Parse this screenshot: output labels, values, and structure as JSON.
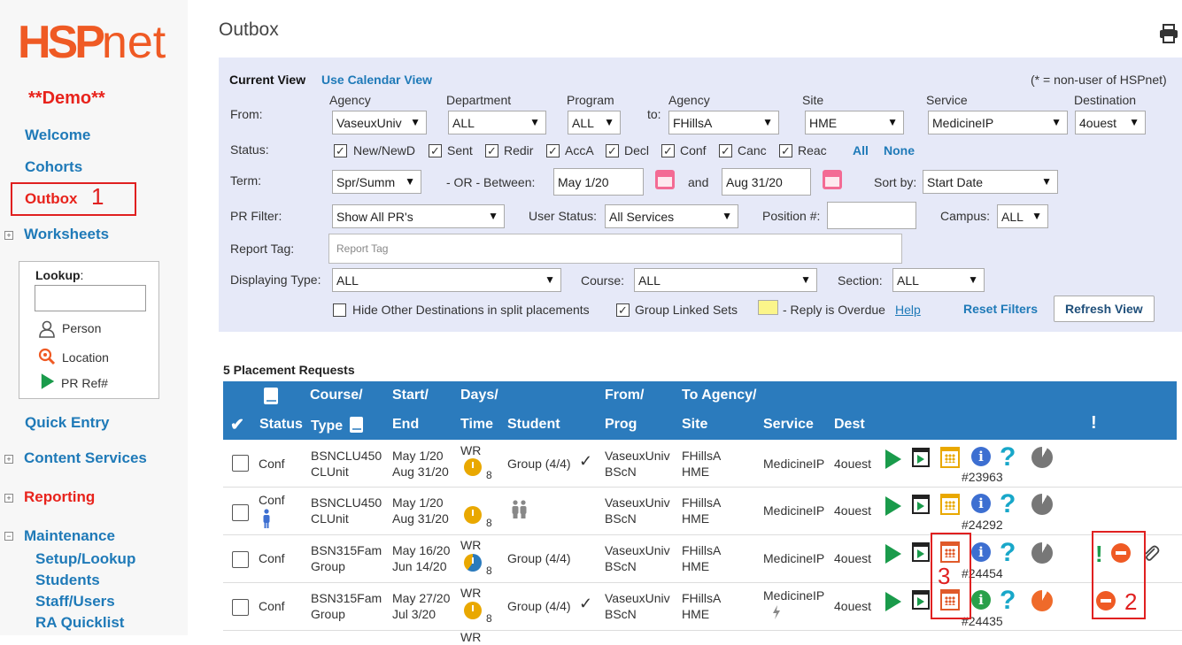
{
  "sidebar": {
    "logo": "HSP",
    "logo_net": "net",
    "demo": "**Demo**",
    "welcome": "Welcome",
    "cohorts": "Cohorts",
    "outbox": "Outbox",
    "worksheets": "Worksheets",
    "lookup_label": "Lookup",
    "lookup_colon": ":",
    "person": "Person",
    "location": "Location",
    "pr_ref": "PR Ref#",
    "quick_entry": "Quick Entry",
    "content_services": "Content Services",
    "reporting": "Reporting",
    "maintenance": "Maintenance",
    "setup_lookup": "Setup/Lookup",
    "students": "Students",
    "staff_users": "Staff/Users",
    "ra_quicklist": "RA Quicklist",
    "plus": "+",
    "minus": "−"
  },
  "annotations": {
    "a1": "1",
    "a2": "2",
    "a3": "3"
  },
  "page": {
    "title": "Outbox"
  },
  "filters": {
    "current_view": "Current View",
    "calendar_view": "Use Calendar View",
    "non_user_note": "(* = non-user of HSPnet)",
    "from": "From:",
    "to": "to:",
    "agency_label": "Agency",
    "department_label": "Department",
    "program_label": "Program",
    "agency_to_label": "Agency",
    "site_label": "Site",
    "service_label": "Service",
    "destination_label": "Destination",
    "agency_value": "VaseuxUniv",
    "department_value": "ALL",
    "program_value": "ALL",
    "agency_to_value": "FHillsA",
    "site_value": "HME",
    "service_value": "MedicineIP",
    "destination_value": "4ouest",
    "status_label": "Status:",
    "statuses": [
      "New/NewD",
      "Sent",
      "Redir",
      "AccA",
      "Decl",
      "Conf",
      "Canc",
      "Reac"
    ],
    "all": "All",
    "none": "None",
    "term_label": "Term:",
    "term_value": "Spr/Summ",
    "or_between": "- OR -  Between:",
    "date_from": "May 1/20",
    "and": "and",
    "date_to": "Aug 31/20",
    "sort_by": "Sort by:",
    "sort_value": "Start Date",
    "pr_filter": "PR Filter:",
    "pr_filter_value": "Show All PR's",
    "user_status": "User Status:",
    "user_status_value": "All Services",
    "position": "Position #:",
    "campus": "Campus:",
    "campus_value": "ALL",
    "report_tag": "Report Tag:",
    "report_tag_placeholder": "Report Tag",
    "displaying_type": "Displaying Type:",
    "displaying_type_value": "ALL",
    "course": "Course:",
    "course_value": "ALL",
    "section": "Section:",
    "section_value": "ALL",
    "hide_other": "Hide Other Destinations in split placements",
    "group_linked": "Group Linked Sets",
    "overdue": "- Reply is Overdue",
    "help": "Help",
    "reset": "Reset Filters",
    "refresh": "Refresh View",
    "check": "✓"
  },
  "table": {
    "count": "5 Placement Requests",
    "headers": {
      "status": "Status",
      "course1": "Course/",
      "course2": "Type",
      "start1": "Start/",
      "start2": "End",
      "days1": "Days/",
      "days2": "Time",
      "student": "Student",
      "from1": "From/",
      "from2": "Prog",
      "to1": "To Agency/",
      "to2": "Site",
      "service": "Service",
      "dest": "Dest",
      "excl": "!",
      "check": "✔"
    },
    "rows": [
      {
        "status": "Conf",
        "course": "BSNCLU450",
        "type": "CLUnit",
        "start": "May 1/20",
        "end": "Aug 31/20",
        "days": "WR",
        "time": "8",
        "student": "Group (4/4)",
        "from": "VaseuxUniv",
        "prog": "BScN",
        "to": "FHillsA",
        "site": "HME",
        "service": "MedicineIP",
        "dest": "4ouest",
        "ref": "#23963"
      },
      {
        "status": "Conf",
        "course": "BSNCLU450",
        "type": "CLUnit",
        "start": "May 1/20",
        "end": "Aug 31/20",
        "days": "",
        "time": "8",
        "student": "",
        "from": "VaseuxUniv",
        "prog": "BScN",
        "to": "FHillsA",
        "site": "HME",
        "service": "MedicineIP",
        "dest": "4ouest",
        "ref": "#24292"
      },
      {
        "status": "Conf",
        "course": "BSN315Fam",
        "type": "Group",
        "start": "May 16/20",
        "end": "Jun 14/20",
        "days": "WR",
        "time": "8",
        "student": "Group (4/4)",
        "from": "VaseuxUniv",
        "prog": "BScN",
        "to": "FHillsA",
        "site": "HME",
        "service": "MedicineIP",
        "dest": "4ouest",
        "ref": "#24454"
      },
      {
        "status": "Conf",
        "course": "BSN315Fam",
        "type": "Group",
        "start": "May 27/20",
        "end": "Jul 3/20",
        "days": "WR",
        "time": "8",
        "student": "Group (4/4)",
        "from": "VaseuxUniv",
        "prog": "BScN",
        "to": "FHillsA",
        "site": "HME",
        "service": "MedicineIP",
        "dest": "4ouest",
        "ref": "#24435"
      }
    ],
    "partial_row_days": "WR"
  },
  "colors": {
    "brand": "#ef5a24",
    "link": "#1f7ab8",
    "header": "#2b7bbd",
    "filter_bg": "#e6e9f8",
    "overdue": "#fbf58a"
  }
}
